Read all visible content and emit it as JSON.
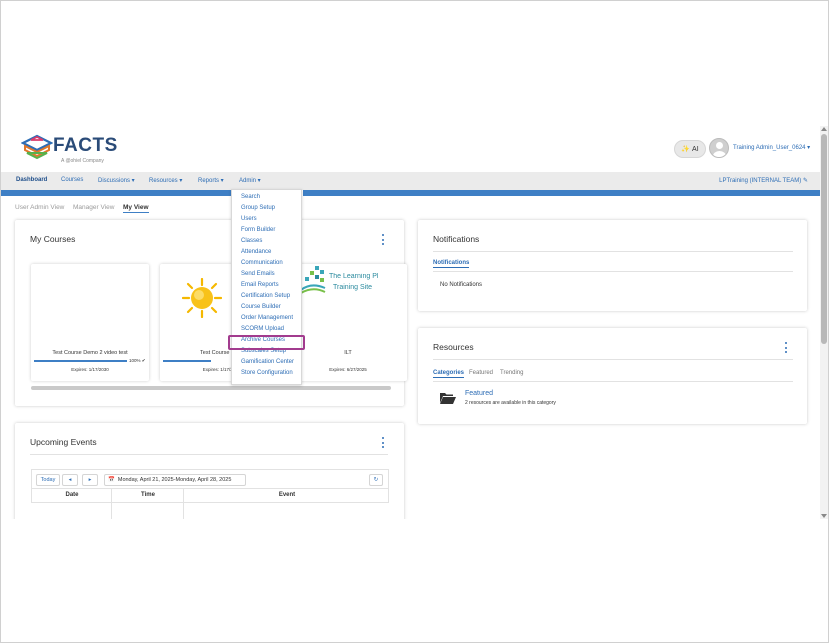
{
  "header": {
    "logo_text": "FACTS",
    "logo_sub": "A @ohiel Company",
    "ai_label": "AI",
    "user_name": "Training Admin_User_0624 ▾"
  },
  "nav": {
    "items": [
      "Dashboard",
      "Courses",
      "Discussions ▾",
      "Resources ▾",
      "Reports ▾",
      "Admin ▾"
    ],
    "right_label": "LPTraining (INTERNAL TEAM) ✎"
  },
  "view_tabs": [
    "User Admin View",
    "Manager View",
    "My View"
  ],
  "my_courses": {
    "title": "My Courses",
    "cards": [
      {
        "name": "Test Course Demo 2 video test",
        "pct": "100% ✔",
        "expires": "Expires: 1/17/2030"
      },
      {
        "name": "Test Course De",
        "expires": "Expires: 1/17/20"
      },
      {
        "name": "ILT",
        "expires": "Expires: 6/27/2025",
        "logo_line1": "The Learning Pl",
        "logo_line2": "Training Site"
      }
    ]
  },
  "upcoming_events": {
    "title": "Upcoming Events",
    "today_label": "Today",
    "prev_label": "◂",
    "next_label": "▸",
    "range": "Monday, April 21, 2025-Monday, April 28, 2025",
    "refresh_label": "↻",
    "columns": [
      "Date",
      "Time",
      "Event"
    ]
  },
  "notifications": {
    "title": "Notifications",
    "tab": "Notifications",
    "empty": "No Notifications"
  },
  "resources": {
    "title": "Resources",
    "tabs": [
      "Categories",
      "Featured",
      "Trending"
    ],
    "category_name": "Featured",
    "category_desc": "2 resources are available in this category"
  },
  "admin_menu": {
    "items": [
      "Search",
      "Group Setup",
      "Users",
      "Form Builder",
      "Classes",
      "Attendance",
      "Communication",
      "Send Emails",
      "Email Reports",
      "Certification Setup",
      "Course Builder",
      "Order Management",
      "SCORM Upload",
      "Archive Courses",
      "Subscales Setup",
      "Gamification Center",
      "Store Configuration"
    ],
    "highlighted": "Archive Courses"
  },
  "colors": {
    "accent": "#3e7fc5",
    "link": "#2d6db5",
    "highlight": "#a23b8e"
  }
}
